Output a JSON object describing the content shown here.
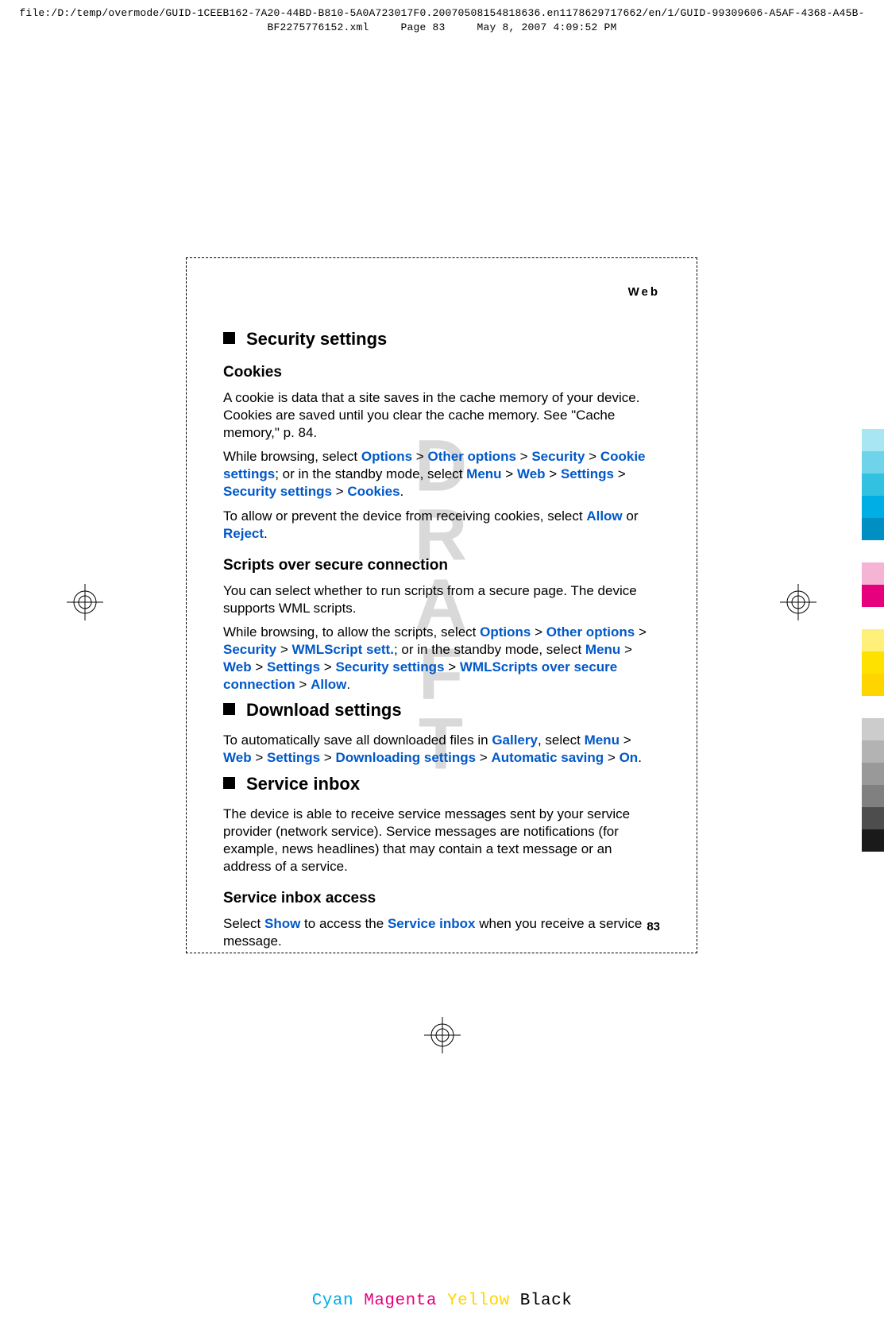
{
  "header": {
    "line1": "file:/D:/temp/overmode/GUID-1CEEB162-7A20-44BD-B810-5A0A723017F0.20070508154818636.en1178629717662/en/1/GUID-99309606-A5AF-4368-A45B-",
    "line2_left": "BF2275776152.xml",
    "line2_mid": "Page 83",
    "line2_right": "May 8, 2007 4:09:52 PM"
  },
  "running_head": "Web",
  "watermark": "DRAFT",
  "sections": {
    "security": {
      "title": "Security settings",
      "cookies": {
        "title": "Cookies",
        "p1": "A cookie is data that a site saves in the cache memory of your device. Cookies are saved until you clear the cache memory. See \"Cache memory,\" p. 84.",
        "p2_a": "While browsing, select ",
        "p2_b": "; or in the standby mode, select ",
        "p2_c": ".",
        "path1": [
          "Options",
          "Other options",
          "Security",
          "Cookie settings"
        ],
        "path2": [
          "Menu",
          "Web",
          "Settings",
          "Security settings",
          "Cookies"
        ],
        "p3_a": "To allow or prevent the device from receiving cookies, select ",
        "p3_or": " or ",
        "p3_end": ".",
        "allow": "Allow",
        "reject": "Reject"
      },
      "scripts": {
        "title": "Scripts over secure connection",
        "p1": "You can select whether to run scripts from a secure page. The device supports WML scripts.",
        "p2_a": "While browsing, to allow the scripts, select ",
        "p2_b": "; or in the standby mode, select ",
        "p2_c": ".",
        "path1": [
          "Options",
          "Other options",
          "Security",
          "WMLScript sett."
        ],
        "path2": [
          "Menu",
          "Web",
          "Settings",
          "Security settings",
          "WMLScripts over secure connection",
          "Allow"
        ]
      }
    },
    "download": {
      "title": "Download settings",
      "p1_a": "To automatically save all downloaded files in ",
      "gallery": "Gallery",
      "p1_b": ", select ",
      "p1_c": ".",
      "path": [
        "Menu",
        "Web",
        "Settings",
        "Downloading settings",
        "Automatic saving",
        "On"
      ]
    },
    "inbox": {
      "title": "Service inbox",
      "p1": "The device is able to receive service messages sent by your service provider (network service). Service messages are notifications (for example, news headlines) that may contain a text message or an address of a service.",
      "access": {
        "title": "Service inbox access",
        "p1_a": "Select ",
        "show": "Show",
        "p1_b": " to access the ",
        "inbox": "Service inbox",
        "p1_c": " when you receive a service message."
      }
    }
  },
  "page_number": "83",
  "footer_colors": {
    "cyan": "Cyan",
    "magenta": "Magenta",
    "yellow": "Yellow",
    "black": "Black"
  },
  "right_swatches": [
    "#a7e6f2",
    "#6fd3ea",
    "#33c1e1",
    "#00aee6",
    "#008fc3",
    "#f5b4d4",
    "#e6007e",
    "#fff07a",
    "#ffe100",
    "#ffd500",
    "#cccccc",
    "#b3b3b3",
    "#999999",
    "#808080",
    "#4d4d4d",
    "#1a1a1a"
  ]
}
